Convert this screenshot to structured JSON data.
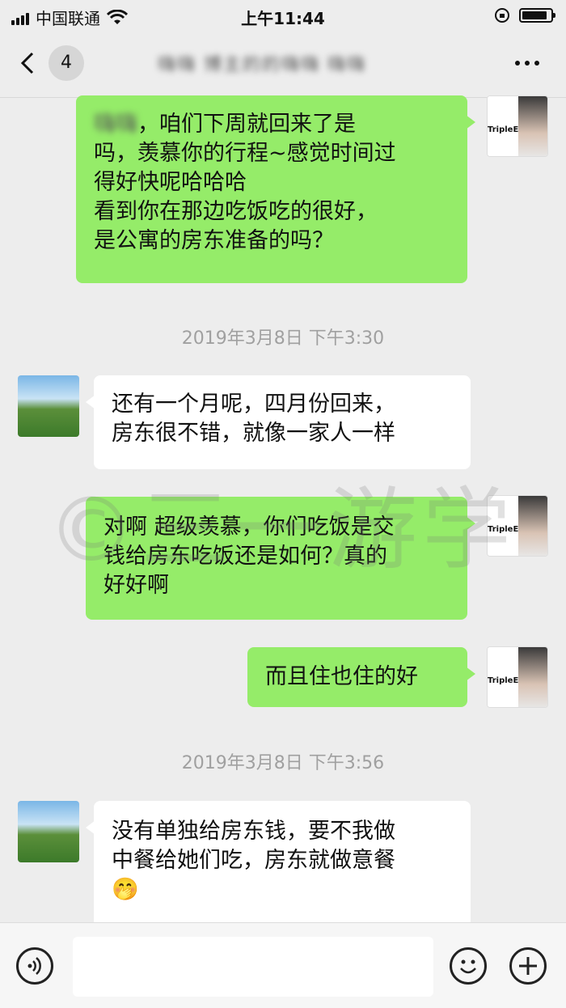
{
  "status_bar": {
    "carrier": "中国联通",
    "time": "上午11:44"
  },
  "nav": {
    "back_icon": "chevron-left-icon",
    "unread_count": "4",
    "title": "嗨嗨 博主的的嗨嗨 嗨嗨",
    "more_icon": "more-dots-icon"
  },
  "watermark": "©三一游学",
  "messages": [
    {
      "side": "me",
      "blurred_name": "嗨嗨",
      "lines": [
        "，咱们下周就回来了是",
        "吗，羡慕你的行程~感觉时间过",
        "得好快呢哈哈哈",
        "看到你在那边吃饭吃的很好，",
        "是公寓的房东准备的吗？"
      ]
    },
    {
      "timestamp": "2019年3月8日 下午3:30"
    },
    {
      "side": "them",
      "lines": [
        "还有一个月呢，四月份回来，",
        "房东很不错，就像一家人一样"
      ]
    },
    {
      "side": "me",
      "lines": [
        "对啊 超级羡慕，你们吃饭是交",
        "钱给房东吃饭还是如何？真的",
        "好好啊"
      ]
    },
    {
      "side": "me",
      "lines": [
        "而且住也住的好"
      ]
    },
    {
      "timestamp": "2019年3月8日 下午3:56"
    },
    {
      "side": "them",
      "lines": [
        "没有单独给房东钱，要不我做",
        "中餐给她们吃，房东就做意餐",
        "🤭"
      ]
    }
  ],
  "avatar_me_text": "TripleE",
  "input_bar": {
    "voice_icon": "voice-icon",
    "emoji_icon": "emoji-icon",
    "plus_icon": "plus-icon"
  }
}
